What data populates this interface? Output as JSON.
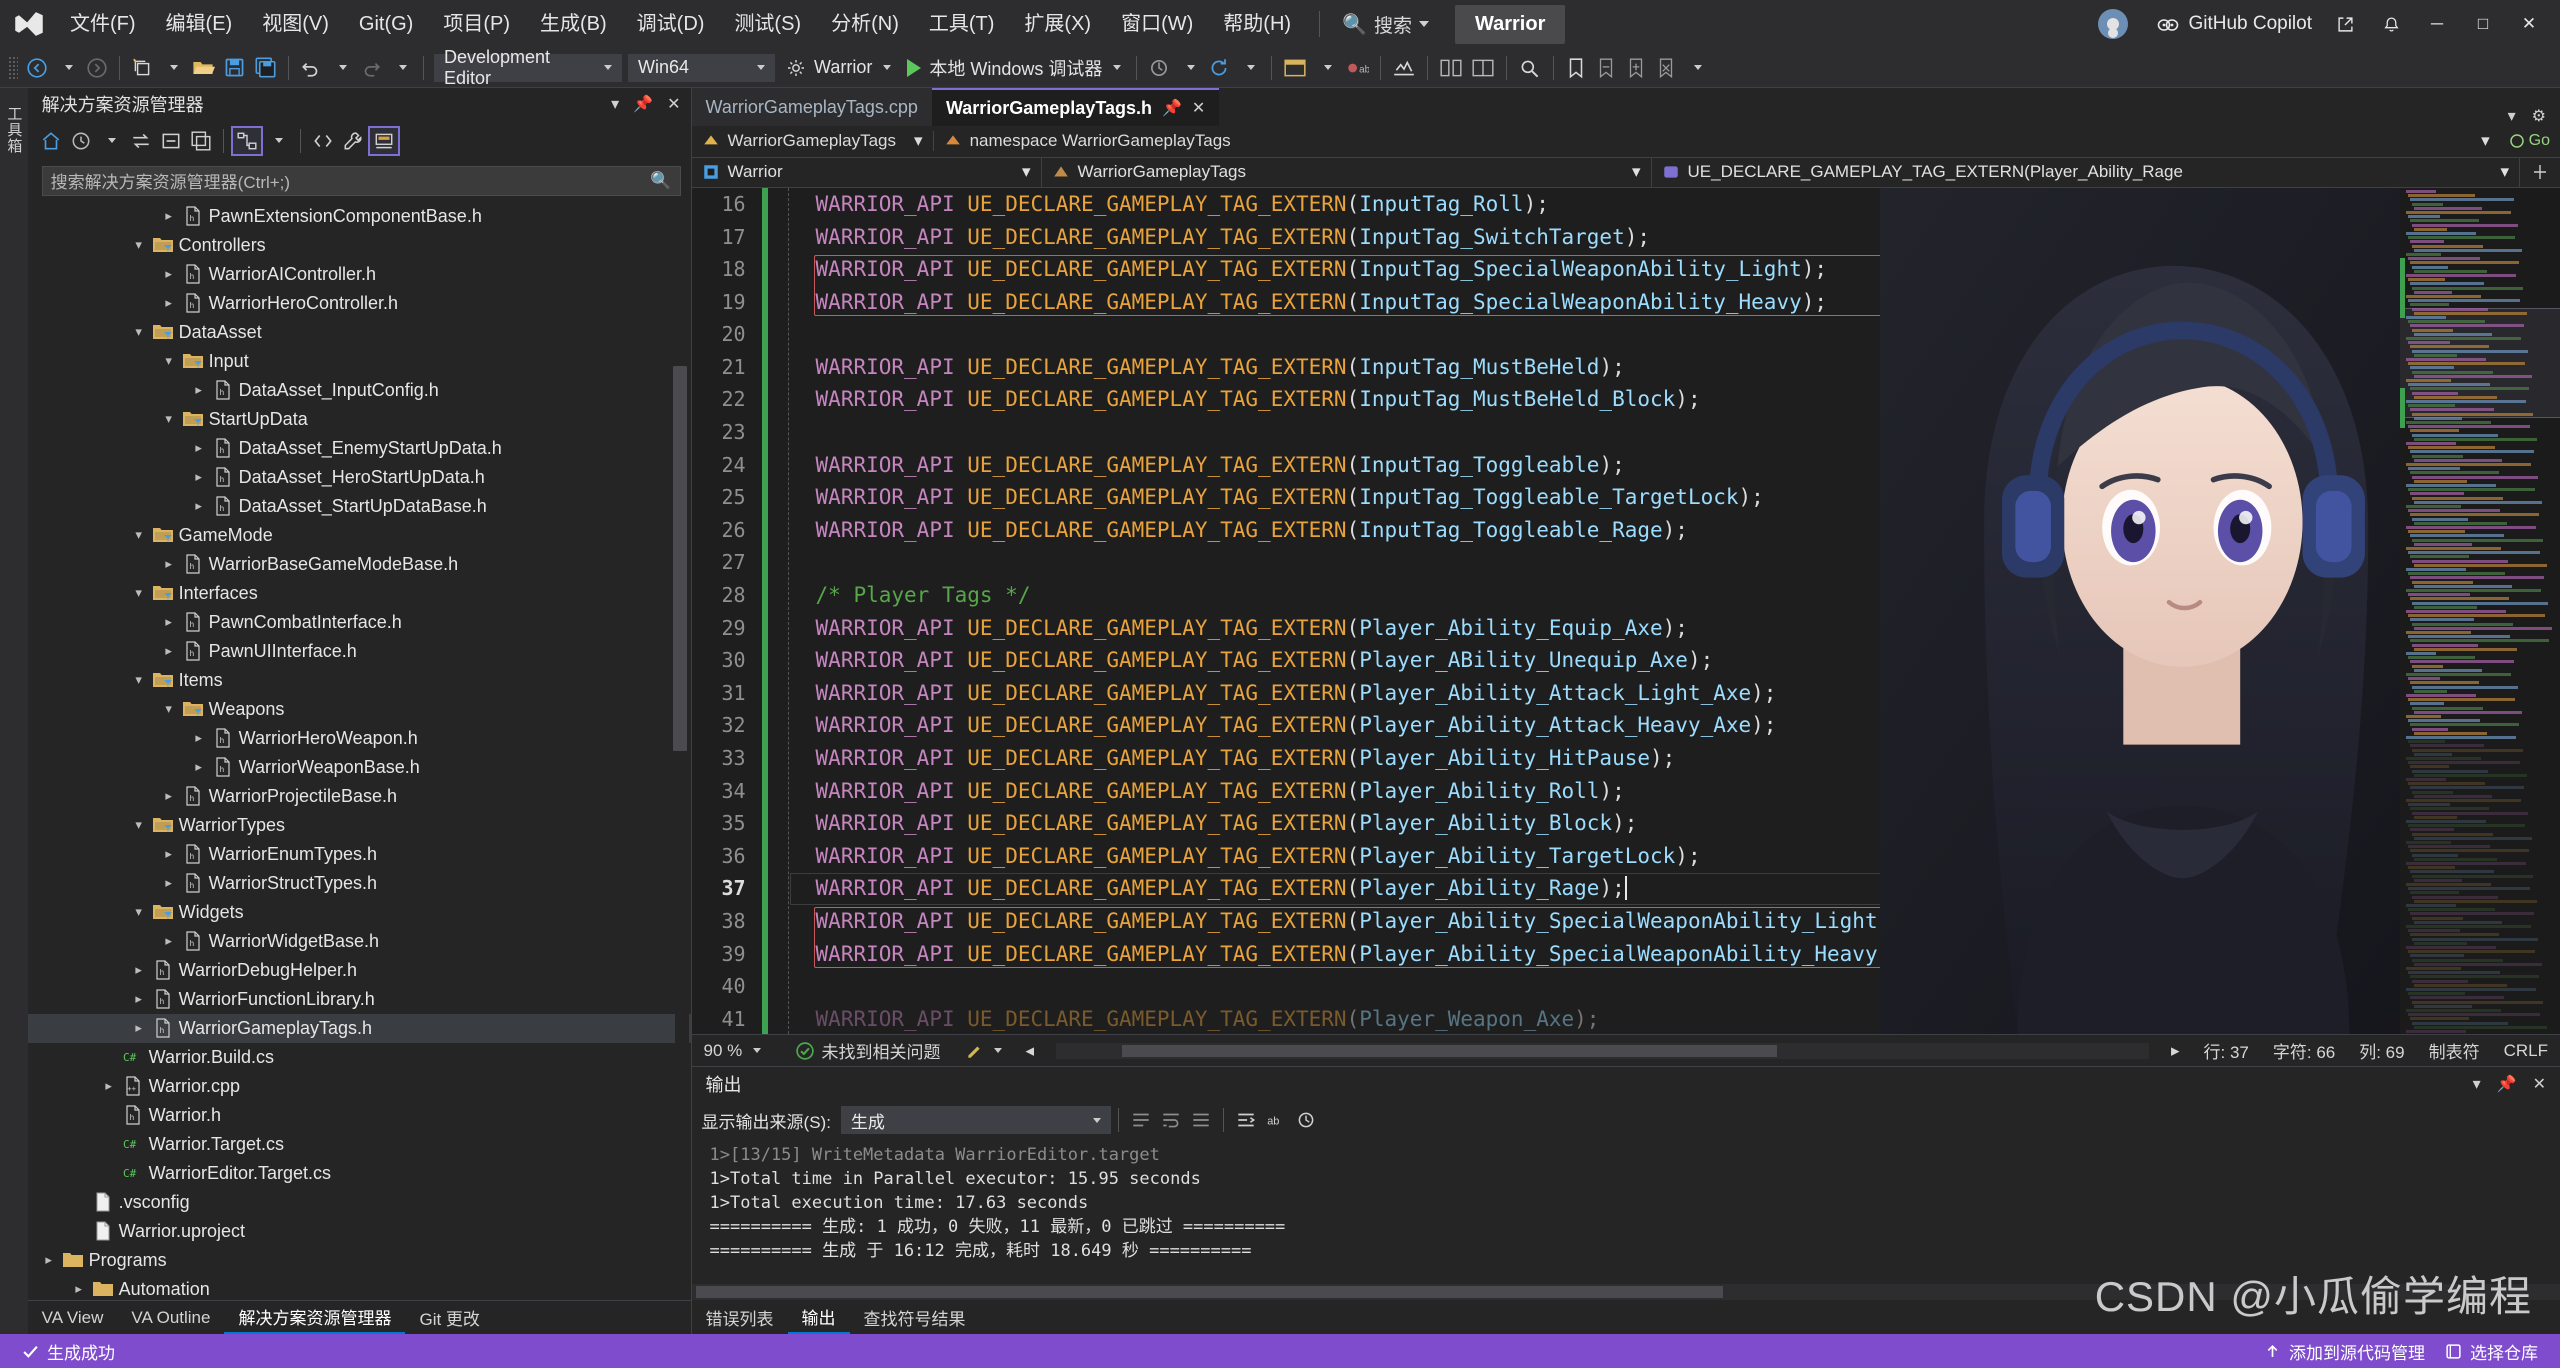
{
  "titlebar": {
    "logo": "vs-logo",
    "menus": [
      "文件(F)",
      "编辑(E)",
      "视图(V)",
      "Git(G)",
      "项目(P)",
      "生成(B)",
      "调试(D)",
      "测试(S)",
      "分析(N)",
      "工具(T)",
      "扩展(X)",
      "窗口(W)",
      "帮助(H)"
    ],
    "search_placeholder": "搜索",
    "solution_chip": "Warrior",
    "copilot_label": "GitHub Copilot",
    "window_buttons": [
      "minimize",
      "maximize",
      "close"
    ]
  },
  "toolbar": {
    "config": "Development Editor",
    "platform": "Win64",
    "startup_project": "Warrior",
    "run_label": "本地 Windows 调试器",
    "icons": [
      "back-icon",
      "forward-icon",
      "new-project-icon",
      "open-folder-icon",
      "save-icon",
      "save-all-icon",
      "undo-icon",
      "redo-icon",
      "gear-icon",
      "play-icon",
      "attach-icon",
      "refresh-icon",
      "window-icon",
      "step-icon",
      "call-stack-icon",
      "bookmark-icon"
    ]
  },
  "sidebar_rail": {
    "label": "工具箱"
  },
  "solution_explorer": {
    "title": "解决方案资源管理器",
    "search_placeholder": "搜索解决方案资源管理器(Ctrl+;)",
    "tabs": [
      {
        "label": "VA View",
        "active": false
      },
      {
        "label": "VA Outline",
        "active": false
      },
      {
        "label": "解决方案资源管理器",
        "active": true
      },
      {
        "label": "Git 更改",
        "active": false
      }
    ],
    "tree": [
      {
        "depth": 4,
        "label": "PawnExtensionComponentBase.h",
        "kind": "header",
        "expand": "collapsed"
      },
      {
        "depth": 3,
        "label": "Controllers",
        "kind": "folder",
        "expand": "expanded"
      },
      {
        "depth": 4,
        "label": "WarriorAIController.h",
        "kind": "header",
        "expand": "collapsed"
      },
      {
        "depth": 4,
        "label": "WarriorHeroController.h",
        "kind": "header",
        "expand": "collapsed"
      },
      {
        "depth": 3,
        "label": "DataAsset",
        "kind": "folder",
        "expand": "expanded"
      },
      {
        "depth": 4,
        "label": "Input",
        "kind": "folder",
        "expand": "expanded"
      },
      {
        "depth": 5,
        "label": "DataAsset_InputConfig.h",
        "kind": "header",
        "expand": "collapsed"
      },
      {
        "depth": 4,
        "label": "StartUpData",
        "kind": "folder",
        "expand": "expanded"
      },
      {
        "depth": 5,
        "label": "DataAsset_EnemyStartUpData.h",
        "kind": "header",
        "expand": "collapsed"
      },
      {
        "depth": 5,
        "label": "DataAsset_HeroStartUpData.h",
        "kind": "header",
        "expand": "collapsed"
      },
      {
        "depth": 5,
        "label": "DataAsset_StartUpDataBase.h",
        "kind": "header",
        "expand": "collapsed"
      },
      {
        "depth": 3,
        "label": "GameMode",
        "kind": "folder",
        "expand": "expanded"
      },
      {
        "depth": 4,
        "label": "WarriorBaseGameModeBase.h",
        "kind": "header",
        "expand": "collapsed"
      },
      {
        "depth": 3,
        "label": "Interfaces",
        "kind": "folder",
        "expand": "expanded"
      },
      {
        "depth": 4,
        "label": "PawnCombatInterface.h",
        "kind": "header",
        "expand": "collapsed"
      },
      {
        "depth": 4,
        "label": "PawnUIInterface.h",
        "kind": "header",
        "expand": "collapsed"
      },
      {
        "depth": 3,
        "label": "Items",
        "kind": "folder",
        "expand": "expanded"
      },
      {
        "depth": 4,
        "label": "Weapons",
        "kind": "folder",
        "expand": "expanded"
      },
      {
        "depth": 5,
        "label": "WarriorHeroWeapon.h",
        "kind": "header",
        "expand": "collapsed"
      },
      {
        "depth": 5,
        "label": "WarriorWeaponBase.h",
        "kind": "header",
        "expand": "collapsed"
      },
      {
        "depth": 4,
        "label": "WarriorProjectileBase.h",
        "kind": "header",
        "expand": "collapsed"
      },
      {
        "depth": 3,
        "label": "WarriorTypes",
        "kind": "folder",
        "expand": "expanded"
      },
      {
        "depth": 4,
        "label": "WarriorEnumTypes.h",
        "kind": "header",
        "expand": "collapsed"
      },
      {
        "depth": 4,
        "label": "WarriorStructTypes.h",
        "kind": "header",
        "expand": "collapsed"
      },
      {
        "depth": 3,
        "label": "Widgets",
        "kind": "folder",
        "expand": "expanded"
      },
      {
        "depth": 4,
        "label": "WarriorWidgetBase.h",
        "kind": "header",
        "expand": "collapsed"
      },
      {
        "depth": 3,
        "label": "WarriorDebugHelper.h",
        "kind": "header",
        "expand": "collapsed"
      },
      {
        "depth": 3,
        "label": "WarriorFunctionLibrary.h",
        "kind": "header",
        "expand": "collapsed"
      },
      {
        "depth": 3,
        "label": "WarriorGameplayTags.h",
        "kind": "header",
        "expand": "collapsed",
        "selected": true
      },
      {
        "depth": 2,
        "label": "Warrior.Build.cs",
        "kind": "cs",
        "expand": "none"
      },
      {
        "depth": 2,
        "label": "Warrior.cpp",
        "kind": "cpp",
        "expand": "collapsed"
      },
      {
        "depth": 2,
        "label": "Warrior.h",
        "kind": "header",
        "expand": "none"
      },
      {
        "depth": 2,
        "label": "Warrior.Target.cs",
        "kind": "cs",
        "expand": "none"
      },
      {
        "depth": 2,
        "label": "WarriorEditor.Target.cs",
        "kind": "cs",
        "expand": "none"
      },
      {
        "depth": 1,
        "label": ".vsconfig",
        "kind": "file",
        "expand": "none"
      },
      {
        "depth": 1,
        "label": "Warrior.uproject",
        "kind": "file",
        "expand": "none"
      },
      {
        "depth": 0,
        "label": "Programs",
        "kind": "folder-plain",
        "expand": "collapsed"
      },
      {
        "depth": 1,
        "label": "Automation",
        "kind": "folder-plain",
        "expand": "collapsed"
      }
    ]
  },
  "editor": {
    "tabs": [
      {
        "label": "WarriorGameplayTags.cpp",
        "active": false
      },
      {
        "label": "WarriorGameplayTags.h",
        "active": true,
        "pin": "pin-icon",
        "close": "close-icon"
      }
    ],
    "nav_scope_left": "WarriorGameplayTags",
    "nav_scope_right": "namespace WarriorGameplayTags",
    "go_label": "Go",
    "ctx_project": "Warrior",
    "ctx_namespace": "WarriorGameplayTags",
    "ctx_member": "UE_DECLARE_GAMEPLAY_TAG_EXTERN(Player_Ability_Rage",
    "first_line_no": 16,
    "current_line": 37,
    "lines": [
      {
        "no": 16,
        "api": "WARRIOR_API",
        "macro": "UE_DECLARE_GAMEPLAY_TAG_EXTERN",
        "arg": "InputTag_Roll",
        "changed": true
      },
      {
        "no": 17,
        "api": "WARRIOR_API",
        "macro": "UE_DECLARE_GAMEPLAY_TAG_EXTERN",
        "arg": "InputTag_SwitchTarget",
        "changed": true
      },
      {
        "no": 18,
        "api": "WARRIOR_API",
        "macro": "UE_DECLARE_GAMEPLAY_TAG_EXTERN",
        "arg": "InputTag_SpecialWeaponAbility_Light",
        "changed": true,
        "box": "start"
      },
      {
        "no": 19,
        "api": "WARRIOR_API",
        "macro": "UE_DECLARE_GAMEPLAY_TAG_EXTERN",
        "arg": "InputTag_SpecialWeaponAbility_Heavy",
        "changed": true,
        "box": "end"
      },
      {
        "no": 20,
        "blank": true,
        "changed": true
      },
      {
        "no": 21,
        "api": "WARRIOR_API",
        "macro": "UE_DECLARE_GAMEPLAY_TAG_EXTERN",
        "arg": "InputTag_MustBeHeld",
        "changed": true
      },
      {
        "no": 22,
        "api": "WARRIOR_API",
        "macro": "UE_DECLARE_GAMEPLAY_TAG_EXTERN",
        "arg": "InputTag_MustBeHeld_Block",
        "changed": true
      },
      {
        "no": 23,
        "blank": true,
        "changed": true
      },
      {
        "no": 24,
        "api": "WARRIOR_API",
        "macro": "UE_DECLARE_GAMEPLAY_TAG_EXTERN",
        "arg": "InputTag_Toggleable",
        "changed": true
      },
      {
        "no": 25,
        "api": "WARRIOR_API",
        "macro": "UE_DECLARE_GAMEPLAY_TAG_EXTERN",
        "arg": "InputTag_Toggleable_TargetLock",
        "changed": true
      },
      {
        "no": 26,
        "api": "WARRIOR_API",
        "macro": "UE_DECLARE_GAMEPLAY_TAG_EXTERN",
        "arg": "InputTag_Toggleable_Rage",
        "changed": true
      },
      {
        "no": 27,
        "blank": true,
        "changed": true
      },
      {
        "no": 28,
        "comment": "/* Player Tags */",
        "changed": true
      },
      {
        "no": 29,
        "api": "WARRIOR_API",
        "macro": "UE_DECLARE_GAMEPLAY_TAG_EXTERN",
        "arg": "Player_Ability_Equip_Axe",
        "changed": true
      },
      {
        "no": 30,
        "api": "WARRIOR_API",
        "macro": "UE_DECLARE_GAMEPLAY_TAG_EXTERN",
        "arg": "Player_ABility_Unequip_Axe",
        "changed": true
      },
      {
        "no": 31,
        "api": "WARRIOR_API",
        "macro": "UE_DECLARE_GAMEPLAY_TAG_EXTERN",
        "arg": "Player_Ability_Attack_Light_Axe",
        "changed": true
      },
      {
        "no": 32,
        "api": "WARRIOR_API",
        "macro": "UE_DECLARE_GAMEPLAY_TAG_EXTERN",
        "arg": "Player_Ability_Attack_Heavy_Axe",
        "changed": true
      },
      {
        "no": 33,
        "api": "WARRIOR_API",
        "macro": "UE_DECLARE_GAMEPLAY_TAG_EXTERN",
        "arg": "Player_Ability_HitPause",
        "changed": true
      },
      {
        "no": 34,
        "api": "WARRIOR_API",
        "macro": "UE_DECLARE_GAMEPLAY_TAG_EXTERN",
        "arg": "Player_Ability_Roll",
        "changed": true
      },
      {
        "no": 35,
        "api": "WARRIOR_API",
        "macro": "UE_DECLARE_GAMEPLAY_TAG_EXTERN",
        "arg": "Player_Ability_Block",
        "changed": true
      },
      {
        "no": 36,
        "api": "WARRIOR_API",
        "macro": "UE_DECLARE_GAMEPLAY_TAG_EXTERN",
        "arg": "Player_Ability_TargetLock",
        "changed": true
      },
      {
        "no": 37,
        "api": "WARRIOR_API",
        "macro": "UE_DECLARE_GAMEPLAY_TAG_EXTERN",
        "arg": "Player_Ability_Rage",
        "changed": true,
        "current": true,
        "caret": true
      },
      {
        "no": 38,
        "api": "WARRIOR_API",
        "macro": "UE_DECLARE_GAMEPLAY_TAG_EXTERN",
        "arg": "Player_Ability_SpecialWeaponAbility_Light",
        "changed": true,
        "box": "start"
      },
      {
        "no": 39,
        "api": "WARRIOR_API",
        "macro": "UE_DECLARE_GAMEPLAY_TAG_EXTERN",
        "arg": "Player_Ability_SpecialWeaponAbility_Heavy",
        "changed": true,
        "box": "end"
      },
      {
        "no": 40,
        "blank": true,
        "changed": true
      },
      {
        "no": 41,
        "api": "WARRIOR_API",
        "macro": "UE_DECLARE_GAMEPLAY_TAG_EXTERN",
        "arg": "Player_Weapon_Axe",
        "changed": true,
        "faded": true
      }
    ],
    "status": {
      "zoom": "90 %",
      "issues": "未找到相关问题",
      "line": "行: 37",
      "chars": "字符: 66",
      "col": "列: 69",
      "tabs": "制表符",
      "eol": "CRLF"
    }
  },
  "output": {
    "title": "输出",
    "source_label": "显示输出来源(S):",
    "source_value": "生成",
    "lines": [
      "1>[13/15] WriteMetadata WarriorEditor.target",
      "1>Total time in Parallel executor: 15.95 seconds",
      "1>Total execution time: 17.63 seconds",
      "========== 生成: 1 成功，0 失败，11 最新，0 已跳过 ==========",
      "========== 生成 于 16:12 完成，耗时 18.649 秒 =========="
    ],
    "tabs": [
      {
        "label": "错误列表",
        "active": false
      },
      {
        "label": "输出",
        "active": true
      },
      {
        "label": "查找符号结果",
        "active": false
      }
    ],
    "toolbar_icons": [
      "clear-icon",
      "wrap-icon",
      "filter-icon",
      "word-wrap-icon",
      "find-icon",
      "clock-icon"
    ]
  },
  "statusbar": {
    "state": "生成成功",
    "source_control": "添加到源代码管理",
    "repo": "选择仓库"
  },
  "watermark": "CSDN @小瓜偷学编程",
  "colors": {
    "accent_purple": "#7e4ccd",
    "tab_accent": "#7e6fd2",
    "macro_orange": "#e8a33d",
    "api_magenta": "#c586c0",
    "comment_green": "#57a64a",
    "error_box_red": "#c75a5a",
    "changed_green": "#3ea150",
    "run_green": "#5cc85c"
  }
}
